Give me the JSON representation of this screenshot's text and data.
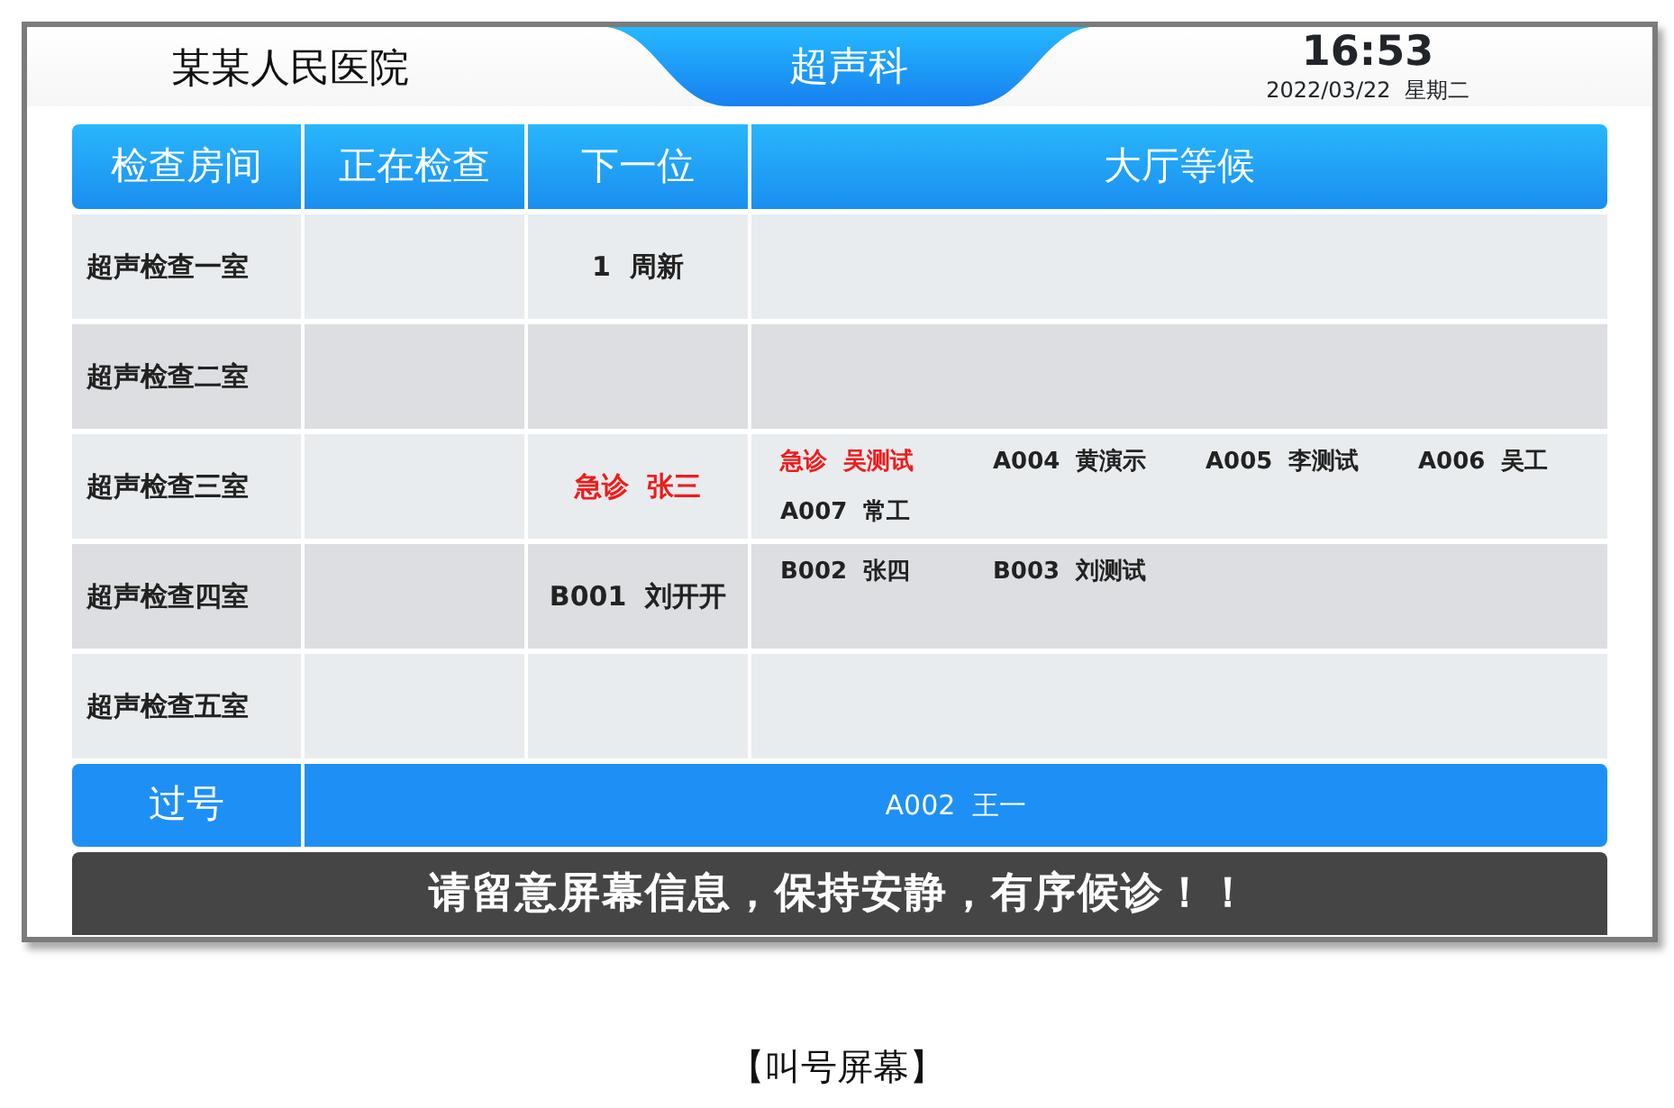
{
  "header": {
    "hospital": "某某人民医院",
    "department": "超声科",
    "time": "16:53",
    "date": "2022/03/22  星期二"
  },
  "table": {
    "columns": [
      "检查房间",
      "正在检查",
      "下一位",
      "大厅等候"
    ],
    "rows": [
      {
        "room": "超声检查一室",
        "current": [],
        "next": [
          {
            "text": "1  周新",
            "urgent": false
          }
        ],
        "waiting": []
      },
      {
        "room": "超声检查二室",
        "current": [],
        "next": [],
        "waiting": []
      },
      {
        "room": "超声检查三室",
        "current": [],
        "next": [
          {
            "text": "急诊  张三",
            "urgent": true
          }
        ],
        "waiting": [
          {
            "text": "急诊  吴测试",
            "urgent": true
          },
          {
            "text": "A004  黄演示",
            "urgent": false
          },
          {
            "text": "A005  李测试",
            "urgent": false
          },
          {
            "text": "A006  吴工",
            "urgent": false
          },
          {
            "text": "A007  常工",
            "urgent": false
          }
        ]
      },
      {
        "room": "超声检查四室",
        "current": [],
        "next": [
          {
            "text": "B001  刘开开",
            "urgent": false
          }
        ],
        "waiting": [
          {
            "text": "B002  张四",
            "urgent": false
          },
          {
            "text": "B003  刘测试",
            "urgent": false
          }
        ]
      },
      {
        "room": "超声检查五室",
        "current": [],
        "next": [],
        "waiting": []
      }
    ]
  },
  "passed": {
    "label": "过号",
    "names": "A002  王一"
  },
  "notice": "请留意屏幕信息，保持安静，有序候诊！！",
  "caption": "【叫号屏幕】"
}
